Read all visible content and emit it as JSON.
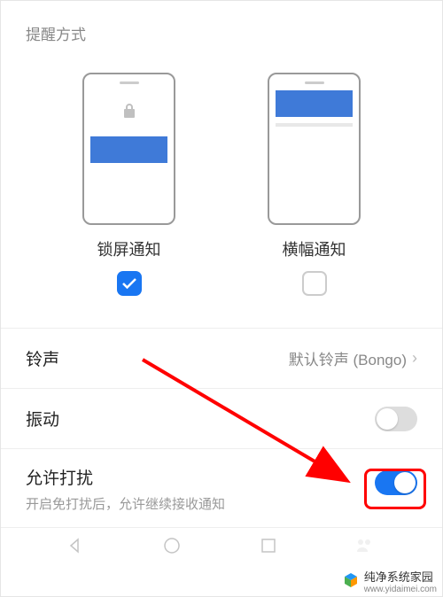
{
  "section_title": "提醒方式",
  "previews": {
    "lock": {
      "label": "锁屏通知",
      "checked": true
    },
    "banner": {
      "label": "横幅通知",
      "checked": false
    }
  },
  "rows": {
    "ringtone": {
      "label": "铃声",
      "value": "默认铃声 (Bongo)"
    },
    "vibrate": {
      "label": "振动",
      "on": false
    },
    "disturb": {
      "label": "允许打扰",
      "sub": "开启免打扰后，允许继续接收通知",
      "on": true
    }
  },
  "watermark": {
    "brand": "纯净系统家园",
    "url": "www.yidaimei.com"
  }
}
